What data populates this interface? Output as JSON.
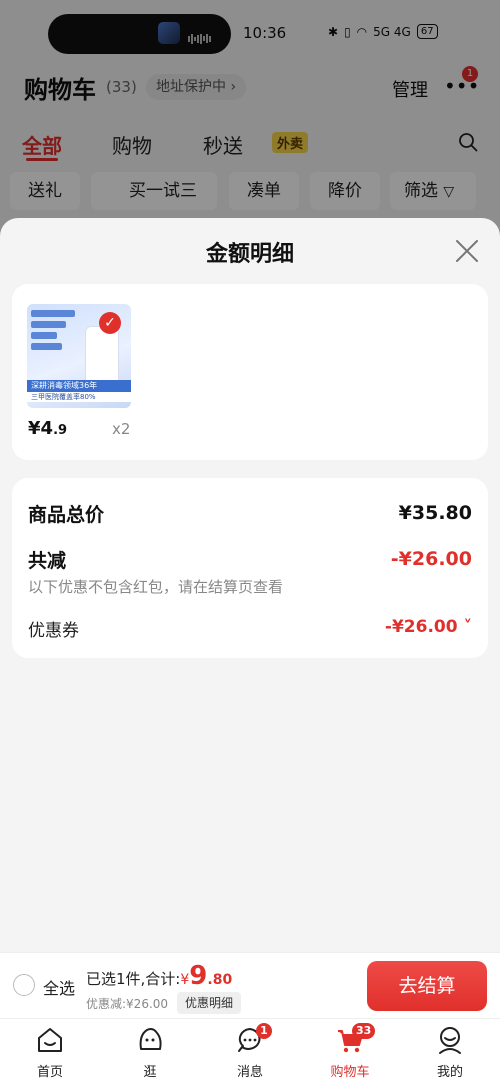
{
  "status_bar": {
    "time": "10:36",
    "battery": "67",
    "network": "5G 4G"
  },
  "background_cart": {
    "title": "购物车",
    "count": "(33)",
    "address_pill": "地址保护中 ›",
    "manage": "管理",
    "more_badge": "1",
    "tabs": [
      {
        "label": "全部"
      },
      {
        "label": "购物"
      },
      {
        "label": "秒送"
      }
    ],
    "tab_badge": "外卖",
    "filters": [
      "送礼",
      "买一试三",
      "凑单",
      "降价",
      "筛选"
    ]
  },
  "sheet": {
    "title": "金额明细",
    "product": {
      "price_int": "¥4",
      "price_dec": ".9",
      "qty": "x2",
      "thumb_strip": "深耕消毒领域36年",
      "thumb_strip2": "三甲医院覆盖率80%"
    },
    "totals": {
      "subtotal_label": "商品总价",
      "subtotal_value": "¥35.80",
      "discount_label": "共减",
      "discount_value": "-¥26.00",
      "note": "以下优惠不包含红包，请在结算页查看",
      "coupon_label": "优惠券",
      "coupon_value": "-¥26.00 ˅"
    }
  },
  "checkout": {
    "select_all": "全选",
    "selected_text": "已选1件,合计:",
    "total_currency": "¥",
    "total_int": "9",
    "total_dec": ".80",
    "discount_text": "优惠减:¥26.00",
    "detail_button": "优惠明细",
    "pay_button": "去结算"
  },
  "tabbar": {
    "items": [
      {
        "label": "首页"
      },
      {
        "label": "逛"
      },
      {
        "label": "消息",
        "badge": "1"
      },
      {
        "label": "购物车",
        "badge": "33"
      },
      {
        "label": "我的"
      }
    ]
  },
  "colors": {
    "accent": "#e0302c",
    "sheet_bg": "#f4f4f4",
    "card_bg": "#ffffff"
  }
}
